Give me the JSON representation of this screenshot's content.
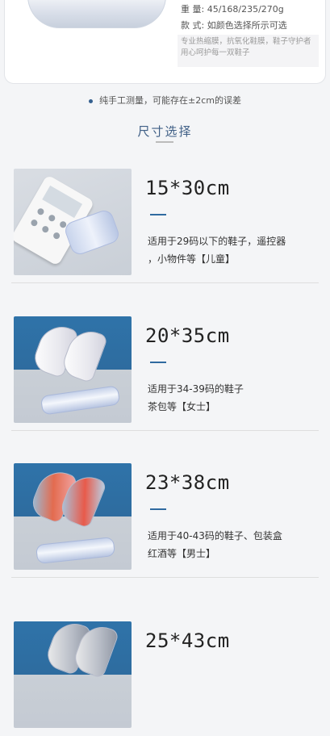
{
  "top_card": {
    "weight_label": "重    量:",
    "weight_value": "45/168/235/270g",
    "style_label": "款    式:",
    "style_value": "如颜色选择所示可选",
    "note": "专业热缩膜，抗氧化鞋膜，鞋子守护者用心呵护每一双鞋子"
  },
  "measure_note": "纯手工测量，可能存在±2cm的误差",
  "section_title": "尺寸选择",
  "sizes": [
    {
      "label": "15*30cm",
      "desc_line1": "适用于29码以下的鞋子，遥控器",
      "desc_line2": "，小物件等【儿童】"
    },
    {
      "label": "20*35cm",
      "desc_line1": "适用于34-39码的鞋子",
      "desc_line2": "茶包等【女士】"
    },
    {
      "label": "23*38cm",
      "desc_line1": "适用于40-43码的鞋子、包装盒",
      "desc_line2": "红酒等【男士】"
    },
    {
      "label": "25*43cm",
      "desc_line1": "",
      "desc_line2": ""
    }
  ],
  "colors": {
    "accent": "#2f6aa0",
    "title": "#3f5f86",
    "background": "#f4f5f7"
  }
}
